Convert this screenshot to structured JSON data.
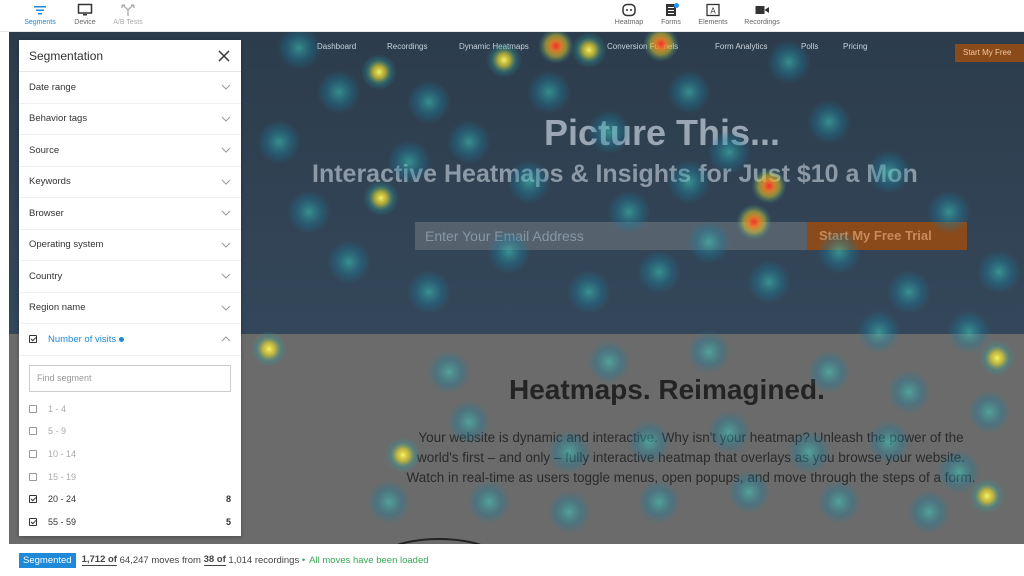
{
  "toolbar": {
    "left": [
      {
        "label": "Segments",
        "icon": "filter-lines-icon",
        "active": true
      },
      {
        "label": "Device",
        "icon": "monitor-icon",
        "active": false
      },
      {
        "label": "A/B Tests",
        "icon": "split-arrows-icon",
        "active": false,
        "disabled": true
      }
    ],
    "right": [
      {
        "label": "Heatmap",
        "icon": "heatmap-icon"
      },
      {
        "label": "Forms",
        "icon": "forms-icon",
        "notification": true
      },
      {
        "label": "Elements",
        "icon": "elements-icon"
      },
      {
        "label": "Recordings",
        "icon": "video-camera-icon"
      }
    ]
  },
  "site": {
    "nav": [
      "Dashboard",
      "Recordings",
      "Dynamic Heatmaps",
      "Conversion Funnels",
      "Form Analytics",
      "Polls",
      "Pricing"
    ],
    "nav_cta": "Start My Free",
    "hero_title": "Picture This...",
    "hero_subtitle": "Interactive Heatmaps & Insights for Just $10 a Mon",
    "email_placeholder": "Enter Your Email Address",
    "cta_button": "Start My Free Trial",
    "section_title": "Heatmaps. Reimagined.",
    "section_body": "Your website is dynamic and interactive. Why isn't your heatmap? Unleash the power of the world's first – and only – fully interactive heatmap that overlays as you browse your website. Watch in real-time as users toggle menus, open popups, and move through the steps of a form."
  },
  "panel": {
    "title": "Segmentation",
    "filters": [
      "Date range",
      "Behavior tags",
      "Source",
      "Keywords",
      "Browser",
      "Operating system",
      "Country",
      "Region name"
    ],
    "visits_label": "Number of visits",
    "find_placeholder": "Find segment",
    "segments": [
      {
        "label": "1 - 4",
        "checked": false,
        "count": ""
      },
      {
        "label": "5 - 9",
        "checked": false,
        "count": ""
      },
      {
        "label": "10 - 14",
        "checked": false,
        "count": ""
      },
      {
        "label": "15 - 19",
        "checked": false,
        "count": ""
      },
      {
        "label": "20 - 24",
        "checked": true,
        "count": "8"
      },
      {
        "label": "55 - 59",
        "checked": true,
        "count": "5"
      }
    ]
  },
  "status": {
    "badge": "Segmented",
    "moves_shown": "1,712 of",
    "moves_total": "64,247 moves from",
    "recordings_shown": "38 of",
    "recordings_total": "1,014 recordings",
    "separator": "•",
    "loaded": "All moves have been loaded"
  },
  "colors": {
    "accent": "#1e88d9",
    "success": "#3aa655",
    "cta": "#8b4a1a"
  }
}
